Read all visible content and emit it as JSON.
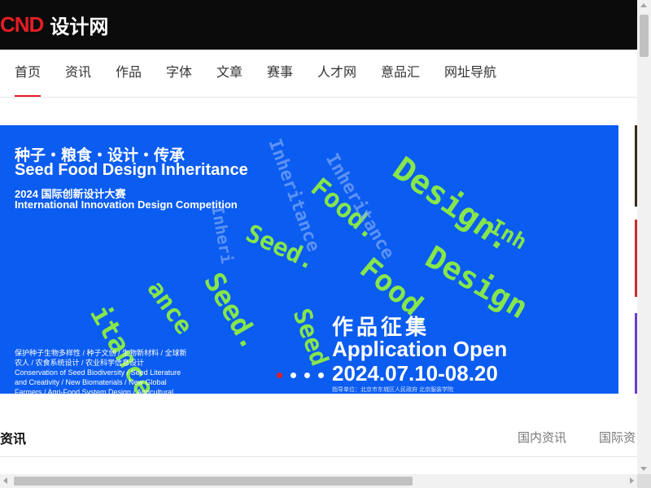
{
  "header": {
    "logo_mark": "CND",
    "logo_text": "设计网"
  },
  "nav": {
    "items": [
      {
        "label": "首页",
        "active": true
      },
      {
        "label": "资讯"
      },
      {
        "label": "作品"
      },
      {
        "label": "字体"
      },
      {
        "label": "文章"
      },
      {
        "label": "赛事"
      },
      {
        "label": "人才网"
      },
      {
        "label": "意品汇"
      },
      {
        "label": "网址导航"
      }
    ]
  },
  "banner": {
    "title_cn": "种子・粮食・设计・传承",
    "title_en": "Seed Food Design Inheritance",
    "subtitle_cn": "2024 国际创新设计大赛",
    "subtitle_en": "International Innovation Design Competition",
    "call_cn": "作品征集",
    "call_en": "Application Open",
    "dates": "2024.07.10-08.20",
    "topics": [
      "保护种子生物多样性 / 种子文创 / 生物新材料 / 全球新",
      "农人 / 农食系统设计 / 农业科学信息设计",
      "Conservation of Seed Biodiversity / Seed Literature",
      "and Creativity / New Biomaterials / New Global",
      "Farmers / Agri-Food System Design / Agricultural"
    ],
    "organizer": "指导单位：北京市东城区人民政府  北京服装学院"
  },
  "colors": {
    "accent": "#e41e26",
    "banner_bg": "#0b5cf0",
    "banner_decor": "#86e64b",
    "topbar_bg": "#0b0b0b"
  },
  "news_section": {
    "title": "资讯",
    "tabs": [
      "国内资讯",
      "国际资"
    ]
  },
  "icons": {
    "scroll_up": "arrow-up-icon",
    "scroll_down": "arrow-down-icon",
    "scroll_left": "arrow-left-icon",
    "scroll_right": "arrow-right-icon"
  }
}
